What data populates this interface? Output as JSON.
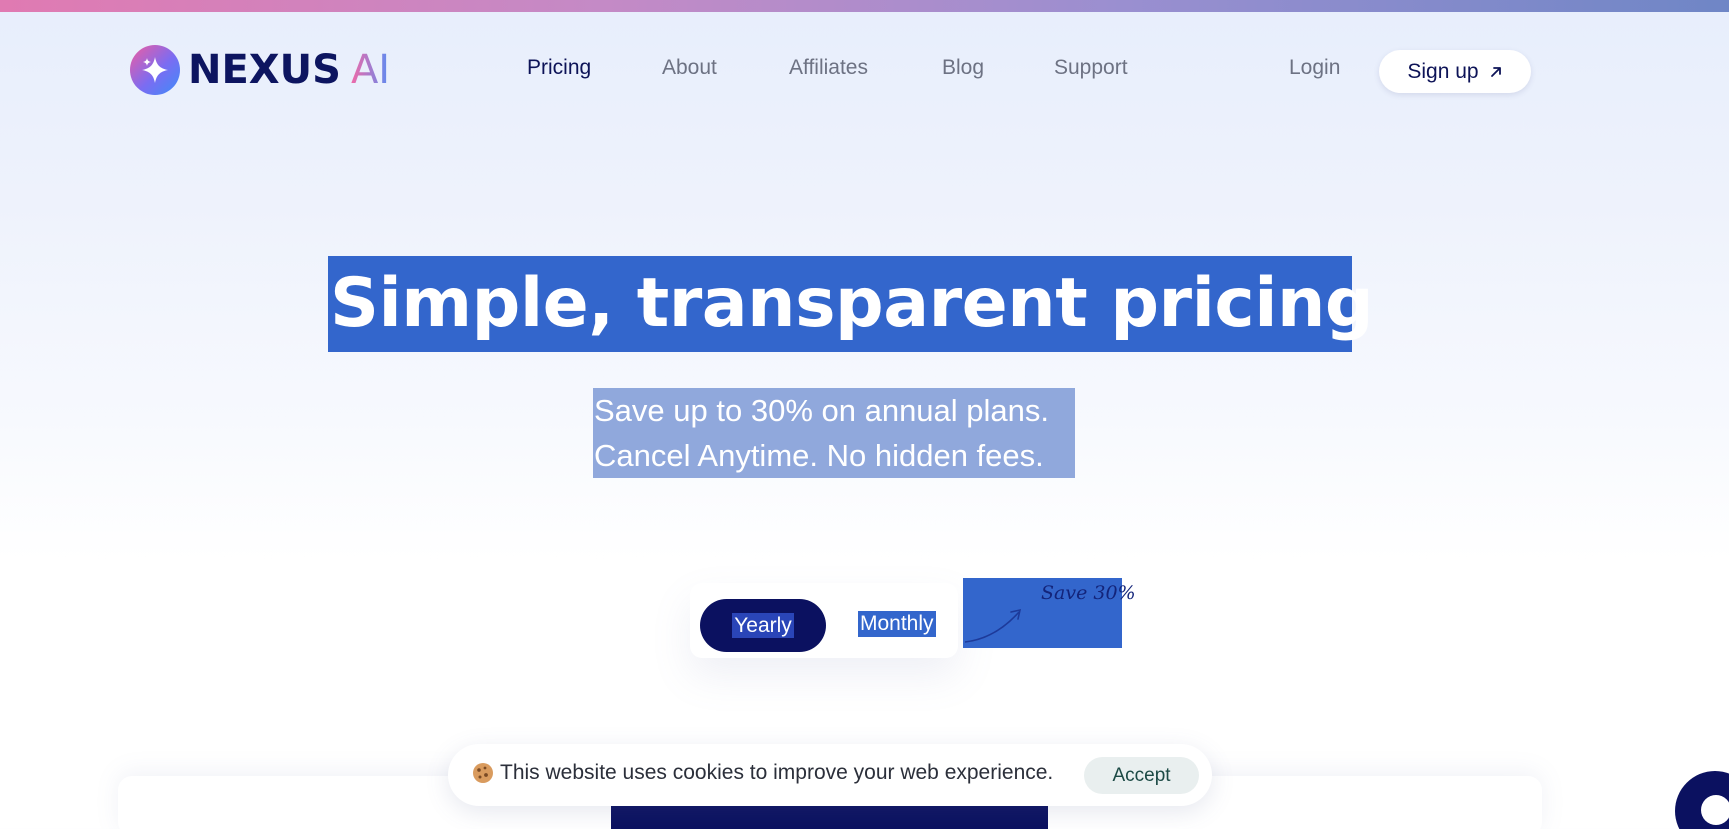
{
  "brand": {
    "name": "NEXUS",
    "suffix": "AI"
  },
  "nav": {
    "items": [
      {
        "label": "Pricing",
        "active": true
      },
      {
        "label": "About",
        "active": false
      },
      {
        "label": "Affiliates",
        "active": false
      },
      {
        "label": "Blog",
        "active": false
      },
      {
        "label": "Support",
        "active": false
      }
    ],
    "login_label": "Login",
    "signup_label": "Sign up"
  },
  "hero": {
    "title": "Simple, transparent pricing",
    "subtitle_line1": "Save up to 30% on annual plans.",
    "subtitle_line2": "Cancel Anytime. No hidden fees."
  },
  "billing_toggle": {
    "options": [
      "Yearly",
      "Monthly"
    ],
    "selected": "Yearly",
    "save_note": "Save 30%"
  },
  "cookie_banner": {
    "icon": "cookie-icon",
    "text": "This website uses cookies to improve your web experience.",
    "accept_label": "Accept"
  },
  "colors": {
    "brand_navy": "#0b1160",
    "selection_blue": "#3366cc",
    "nav_text": "#6d7283",
    "accent_pink": "#f05ca0",
    "accent_blue": "#3d8cf8"
  }
}
